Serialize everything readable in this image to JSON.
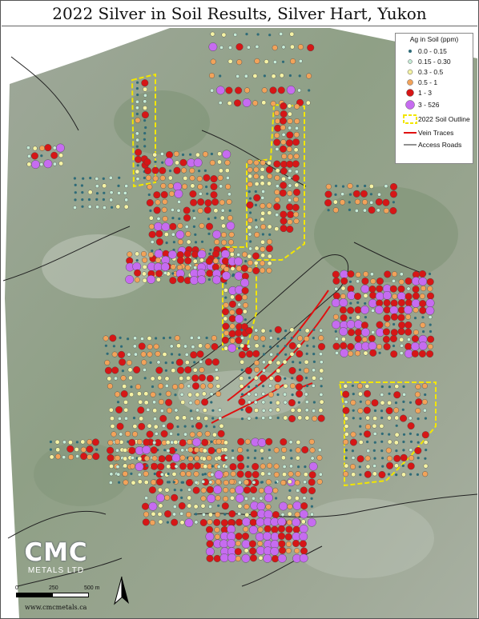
{
  "title": "2022 Silver in Soil Results, Silver Hart, Yukon",
  "legend": {
    "title": "Ag in Soil (ppm)",
    "classes": [
      {
        "label": "0.0 - 0.15",
        "color": "#2f6b78"
      },
      {
        "label": "0.15 - 0.30",
        "color": "#c6ecd7"
      },
      {
        "label": "0.3 - 0.5",
        "color": "#f5f3a5"
      },
      {
        "label": "0.5 - 1",
        "color": "#f2a35a"
      },
      {
        "label": "1 - 3",
        "color": "#d61616"
      },
      {
        "label": "3 - 526",
        "color": "#c66cf0"
      }
    ],
    "soil_outline": {
      "label": "2022 Soil Outline",
      "color": "#f2e600"
    },
    "vein_traces": {
      "label": "Vein Traces",
      "color": "#e01010"
    },
    "access_roads": {
      "label": "Access Roads",
      "color": "#222222"
    }
  },
  "logo": {
    "main": "CMC",
    "sub": "METALS LTD"
  },
  "scale_bar": {
    "labels": [
      "0",
      "250",
      "500 m"
    ]
  },
  "website": "www.cmcmetals.ca",
  "north_arrow": "north-arrow-icon"
}
